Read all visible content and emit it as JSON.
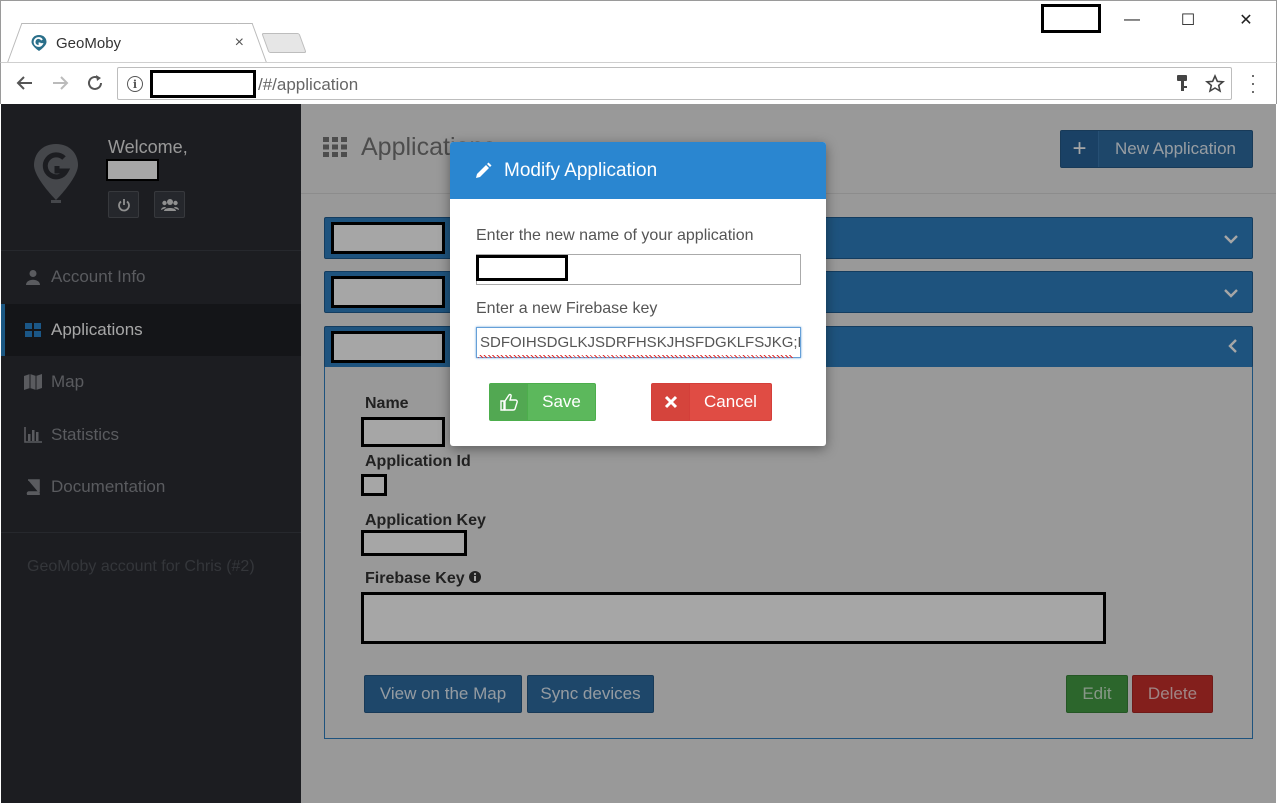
{
  "browser": {
    "tab_title": "GeoMoby",
    "tab_close": "×",
    "url_suffix": "/#/application",
    "window_controls": [
      "—",
      "☐",
      "✕"
    ]
  },
  "sidebar": {
    "welcome": "Welcome,",
    "items": [
      {
        "label": "Account Info",
        "icon": "user-icon"
      },
      {
        "label": "Applications",
        "icon": "grid-icon",
        "active": true
      },
      {
        "label": "Map",
        "icon": "map-icon"
      },
      {
        "label": "Statistics",
        "icon": "bar-chart-icon"
      },
      {
        "label": "Documentation",
        "icon": "book-icon"
      }
    ],
    "account_note": "GeoMoby account for Chris (#2)"
  },
  "header": {
    "title": "Applications",
    "new_button": "New Application"
  },
  "panel": {
    "fields": {
      "name": "Name",
      "app_id": "Application Id",
      "app_key": "Application Key",
      "firebase_key": "Firebase Key"
    },
    "buttons": {
      "view_map": "View on the Map",
      "sync": "Sync devices",
      "edit": "Edit",
      "delete": "Delete"
    }
  },
  "modal": {
    "title": "Modify Application",
    "name_label": "Enter the new name of your application",
    "firebase_label": "Enter a new Firebase key",
    "firebase_value": "SDFOIHSDGLKJSDRFHSKJHSFDGKLFSJKG;KI",
    "save": "Save",
    "cancel": "Cancel"
  },
  "colors": {
    "primary": "#2a86d0",
    "sidebar_bg": "#2b2d33",
    "save_green": "#5cb85c",
    "cancel_red": "#e04c44"
  }
}
